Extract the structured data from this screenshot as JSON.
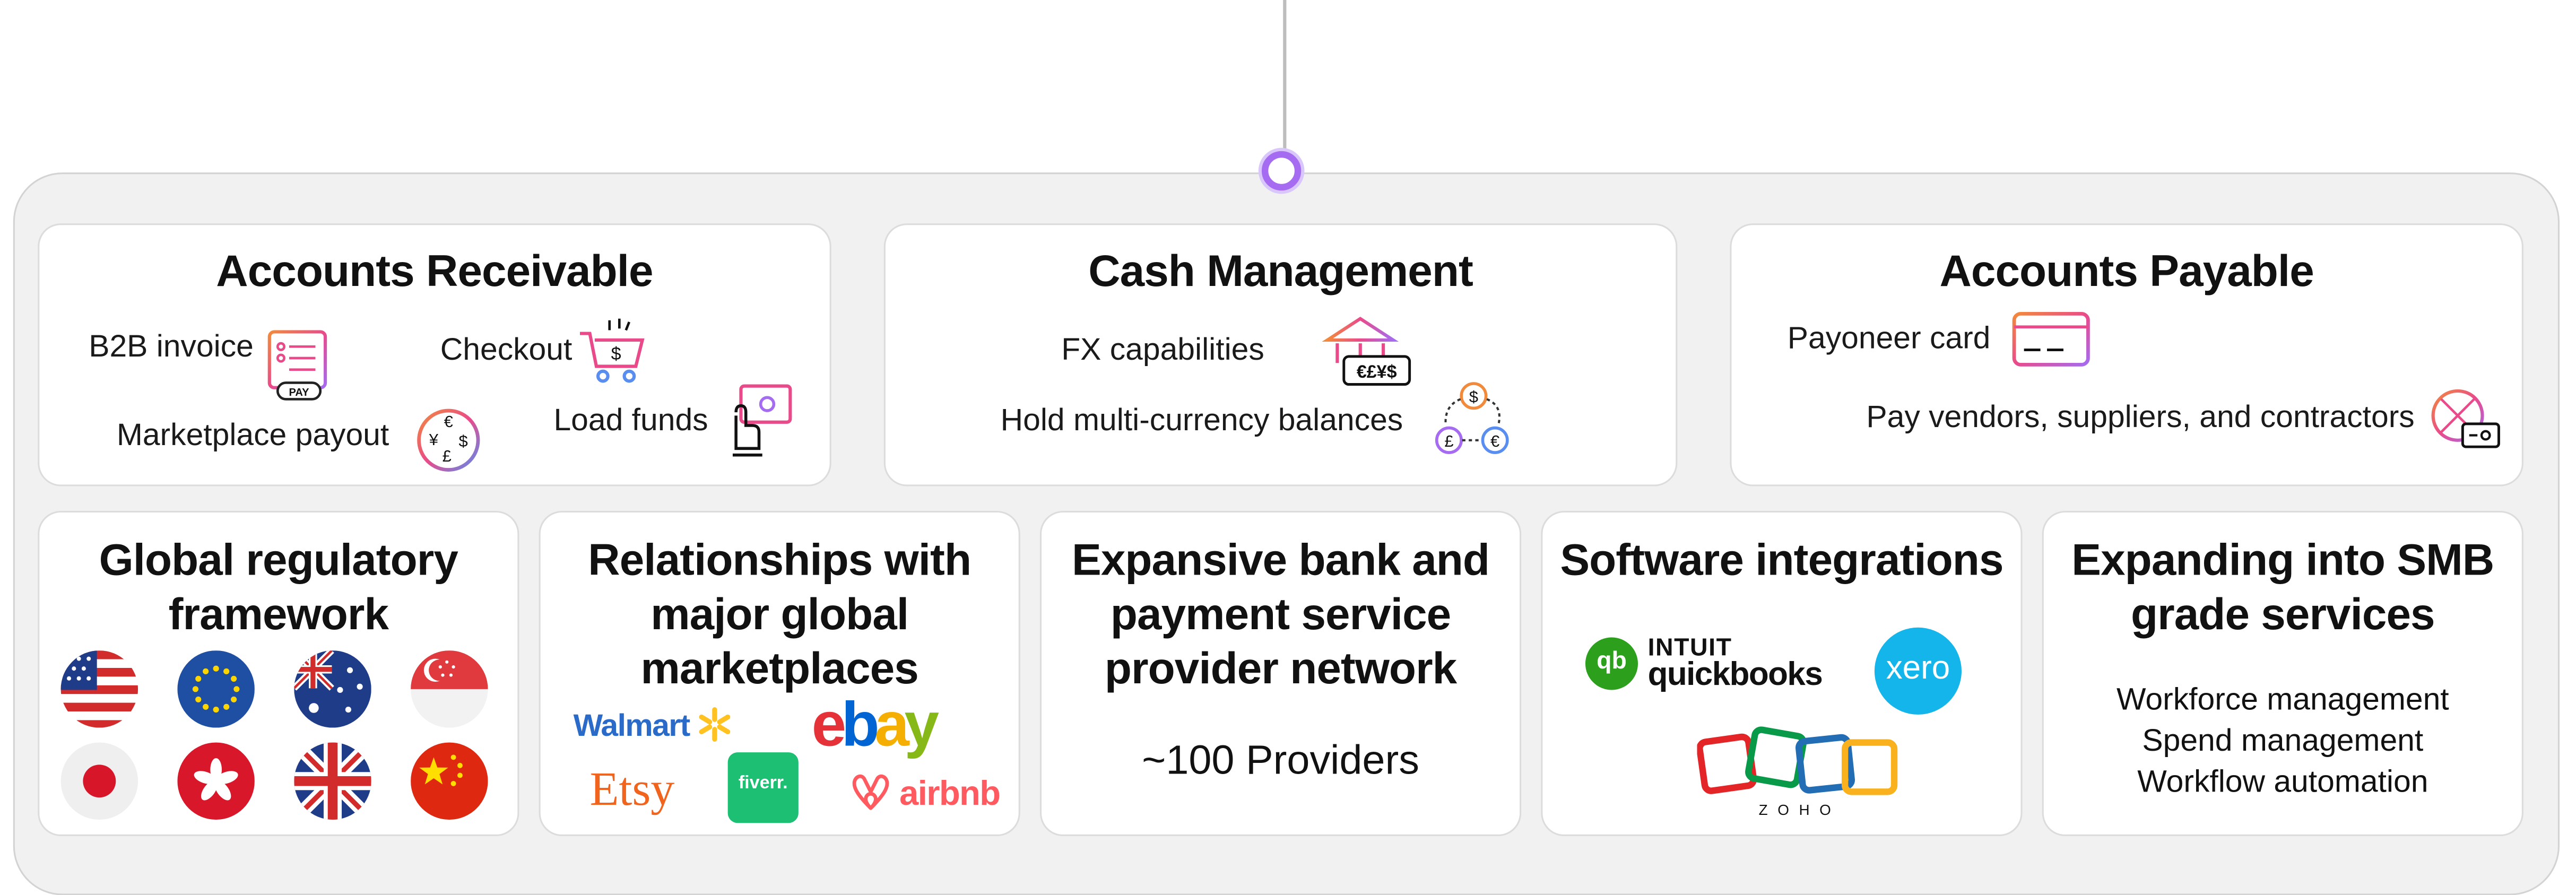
{
  "colors": {
    "accent_purple": "#a56bf0",
    "accent_pink": "#e94b8a",
    "accent_orange": "#f28a3c",
    "accent_blue": "#5a8df0"
  },
  "top_row": {
    "accounts_receivable": {
      "title": "Accounts Receivable",
      "items": [
        {
          "label": "B2B invoice",
          "icon": "invoice-icon",
          "icon_text": "PAY"
        },
        {
          "label": "Checkout",
          "icon": "shopping-cart-icon"
        },
        {
          "label": "Marketplace payout",
          "icon": "currency-exchange-icon"
        },
        {
          "label": "Load funds",
          "icon": "load-funds-icon"
        }
      ]
    },
    "cash_management": {
      "title": "Cash Management",
      "items": [
        {
          "label": "FX capabilities",
          "icon": "bank-icon",
          "icon_text": "€£¥$"
        },
        {
          "label": "Hold multi-currency balances",
          "icon": "multi-currency-icon"
        }
      ]
    },
    "accounts_payable": {
      "title": "Accounts Payable",
      "items": [
        {
          "label": "Payoneer card",
          "icon": "card-icon"
        },
        {
          "label": "Pay vendors, suppliers, and contractors",
          "icon": "pay-vendors-icon"
        }
      ]
    }
  },
  "bottom_row": {
    "regulatory": {
      "title_line1": "Global regulatory",
      "title_line2": "framework",
      "flags": [
        "usa-flag-icon",
        "eu-flag-icon",
        "australia-flag-icon",
        "singapore-flag-icon",
        "japan-flag-icon",
        "hong-kong-flag-icon",
        "uk-flag-icon",
        "china-flag-icon"
      ]
    },
    "marketplaces": {
      "title_line1": "Relationships with",
      "title_line2": "major global",
      "title_line3": "marketplaces",
      "logos": {
        "walmart": "Walmart",
        "ebay_e": "e",
        "ebay_b": "b",
        "ebay_a": "a",
        "ebay_y": "y",
        "etsy": "Etsy",
        "fiverr": "fiverr.",
        "airbnb": "airbnb"
      }
    },
    "bank_network": {
      "title_line1": "Expansive bank and",
      "title_line2": "payment service",
      "title_line3": "provider network",
      "providers": "~100 Providers"
    },
    "software": {
      "title": "Software integrations",
      "logos": {
        "intuit": "INTUIT",
        "quickbooks": "quickbooks",
        "qb_mark": "qb",
        "xero": "xero",
        "zoho": "ZOHO"
      }
    },
    "smb": {
      "title_line1": "Expanding into SMB",
      "title_line2": "grade services",
      "services": [
        "Workforce management",
        "Spend management",
        "Workflow automation"
      ]
    }
  }
}
